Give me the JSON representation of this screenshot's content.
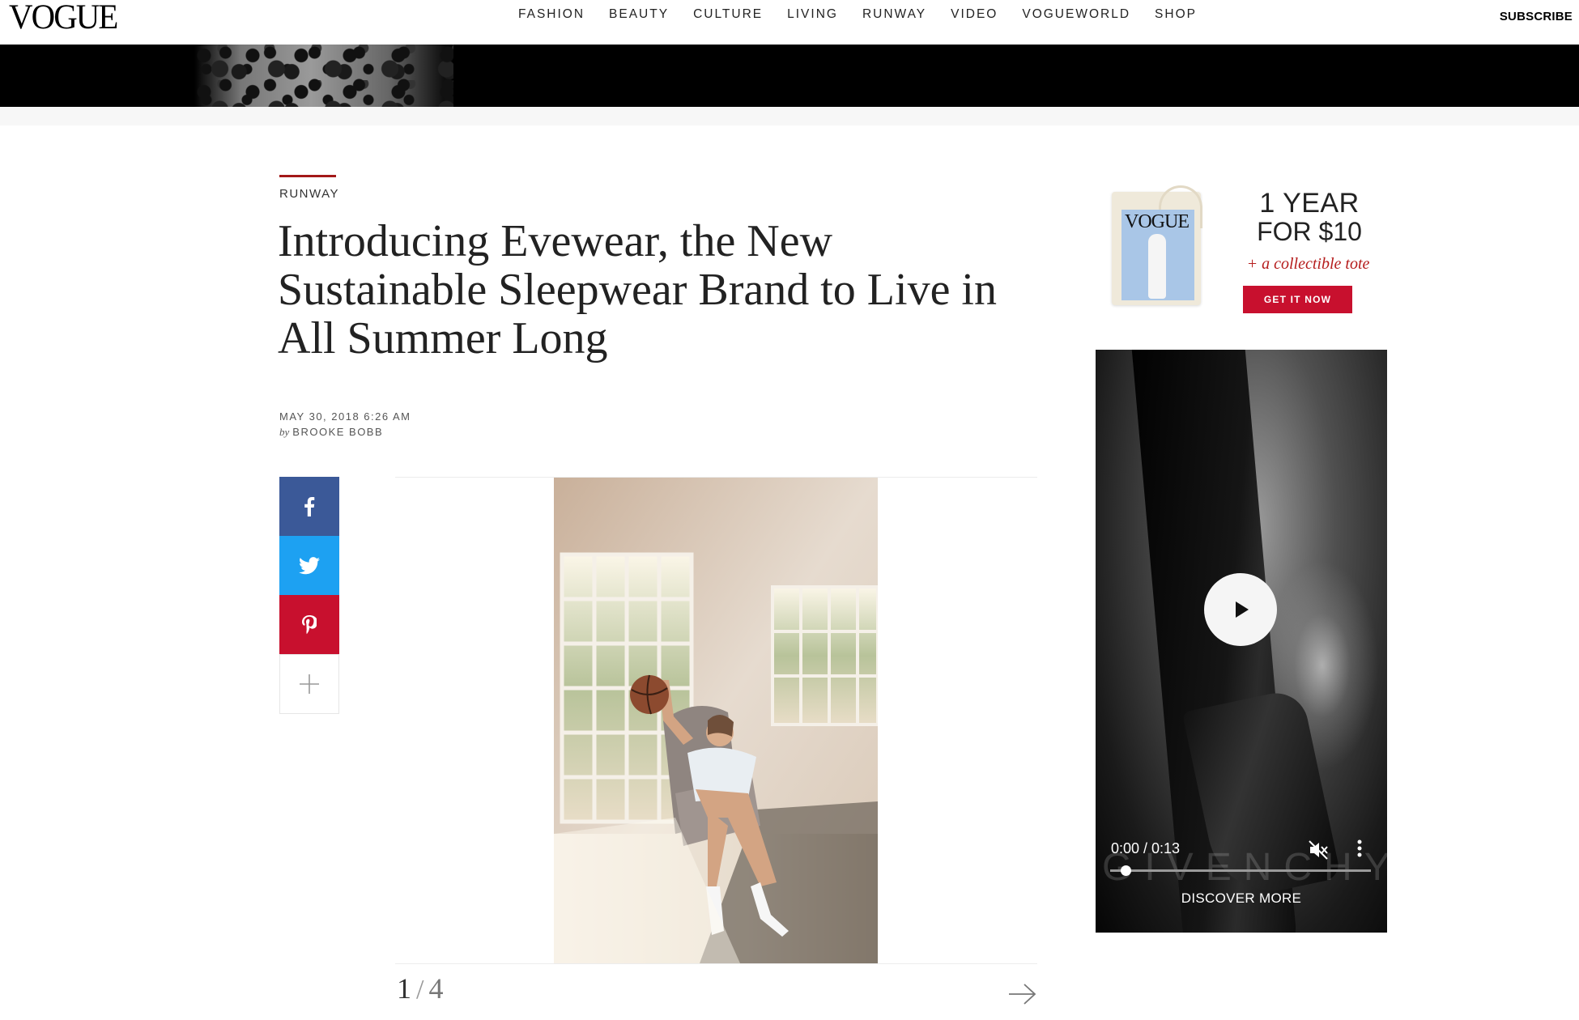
{
  "nav": {
    "logo": "VOGUE",
    "links": [
      "FASHION",
      "BEAUTY",
      "CULTURE",
      "LIVING",
      "RUNWAY",
      "VIDEO",
      "VOGUEWORLD",
      "SHOP"
    ],
    "subscribe": "SUBSCRIBE"
  },
  "article": {
    "rubric": "RUNWAY",
    "headline": "Introducing Evewear, the New Sustainable Sleepwear Brand to Live in All Summer Long",
    "date": "MAY 30, 2018 6:26 AM",
    "by_prefix": "by",
    "author": "BROOKE BOBB"
  },
  "share": {
    "facebook_icon": "facebook-icon",
    "twitter_icon": "twitter-icon",
    "pinterest_icon": "pinterest-icon",
    "more_icon": "plus-icon",
    "colors": {
      "facebook": "#3b5998",
      "twitter": "#1da1f2",
      "pinterest": "#c8102e"
    }
  },
  "gallery": {
    "current": "1",
    "separator": "/",
    "total": "4",
    "next_icon": "arrow-right-icon"
  },
  "sidebar": {
    "subscription_ad": {
      "tote_logo": "VOGUE",
      "line1": "1 YEAR",
      "line2": "FOR $10",
      "line3": "+ a collectible tote",
      "button": "GET IT NOW",
      "accent": "#c8102e"
    },
    "video_ad": {
      "time": "0:00 / 0:13",
      "progress_fraction": 0.06,
      "wordmark": "GIVENCHY",
      "cta": "DISCOVER MORE",
      "play_icon": "play-icon",
      "mute_icon": "muted-speaker-icon",
      "menu_icon": "kebab-menu-icon"
    }
  }
}
